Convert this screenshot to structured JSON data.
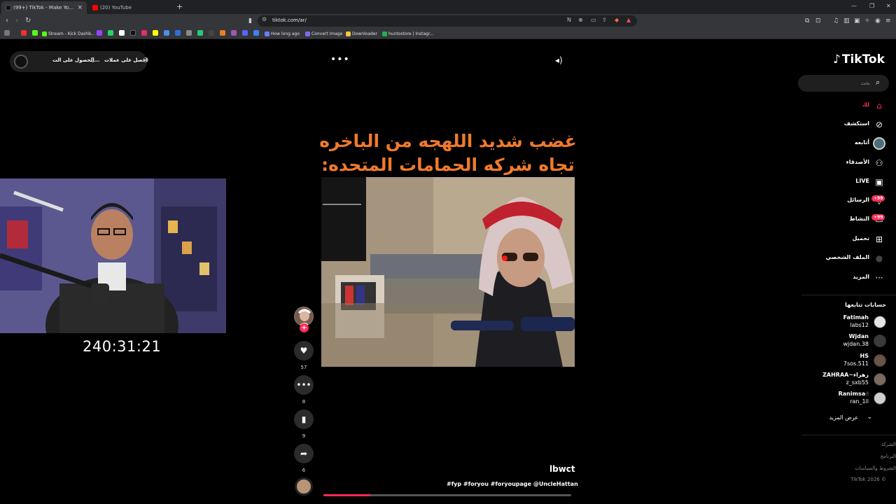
{
  "browser": {
    "tabs": [
      {
        "title": "(99+) TikTok - Make Your Day",
        "active": true
      },
      {
        "title": "(20) YouTube",
        "active": false
      }
    ],
    "new_tab": "+",
    "url": "tiktok.com/ar/",
    "bookmarks": [
      "Stream - Kick Dashb...",
      "How long ago",
      "Convert Image",
      "Downloader",
      "huntostore | Instagr..."
    ],
    "extension_badge": "4"
  },
  "tiktok": {
    "logo": "TikTok",
    "search_placeholder": "بحث",
    "get_app": {
      "item1": "احصل على عملات",
      "item2": "الحصول على الت..."
    },
    "more_dots": "•••",
    "nav": [
      {
        "label": "لك",
        "icon": "home-icon"
      },
      {
        "label": "استكشف",
        "icon": "explore-icon"
      },
      {
        "label": "أتابعه",
        "icon": "following-icon"
      },
      {
        "label": "الأصدقاء",
        "icon": "friends-icon"
      },
      {
        "label": "LIVE",
        "icon": "live-icon"
      },
      {
        "label": "الرسائل",
        "icon": "messages-icon",
        "badge": "+99"
      },
      {
        "label": "النشاط",
        "icon": "activity-icon",
        "badge": "+99"
      },
      {
        "label": "تحميل",
        "icon": "upload-icon"
      },
      {
        "label": "الملف الشخصي",
        "icon": "profile-icon"
      },
      {
        "label": "المزيد",
        "icon": "more-icon"
      }
    ],
    "following_title": "حسابات تتابعها",
    "following": [
      {
        "name": "Fatimah",
        "user": "labs12"
      },
      {
        "name": "Wjdan",
        "user": "wjdan.38"
      },
      {
        "name": "HS",
        "user": "7sos.511"
      },
      {
        "name": "ZAHRAA~زهراء",
        "user": "z_sxb55"
      },
      {
        "name": "Ranimsa☝",
        "user": "ran_1il"
      }
    ],
    "see_more": "عرض المزيد",
    "footer": [
      "الشركة",
      "البرنامج",
      "الشروط والسياسات",
      "© 2026 TikTok"
    ],
    "video": {
      "overlay_line1": "غضب شديد اللهجه من الباخره",
      "overlay_line2": "تجاه شركه الحمامات المتحده:",
      "stream_timer": "240:31:21",
      "author": "lbwct",
      "caption": "#fyp #foryou #foryoupage @UncleHattan",
      "likes": "57",
      "comments": "8",
      "saves": "9",
      "shares": "6",
      "progress": 0.19
    }
  },
  "colors": {
    "accent": "#fe2c55",
    "overlay_text": "#f07a2a"
  }
}
